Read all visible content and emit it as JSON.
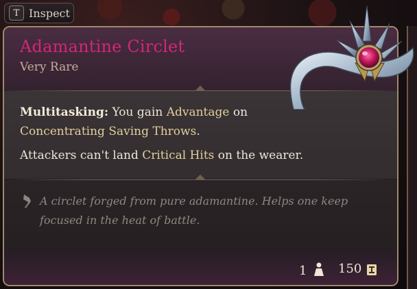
{
  "inspect": {
    "key": "T",
    "label": "Inspect"
  },
  "item": {
    "name": "Adamantine Circlet",
    "rarity": "Very Rare",
    "name_color": "#d4267a"
  },
  "passive": {
    "name": "Multitasking:",
    "text_1": " You gain ",
    "kw_1": "Advantage",
    "text_2": " on ",
    "kw_2": "Concentrating Saving Throws",
    "text_3": "."
  },
  "line2": {
    "text_1": "Attackers can't land ",
    "kw_1": "Critical Hits",
    "text_2": " on the wearer."
  },
  "lore": "A circlet forged from pure adamantine. Helps one keep focused in the heat of battle.",
  "footer": {
    "weight": "1",
    "gold": "150"
  },
  "icons": {
    "key": "keyboard-key-icon",
    "item": "circlet-item-icon",
    "lore": "quill-icon",
    "weight": "weight-icon",
    "gold": "gold-coin-icon"
  }
}
